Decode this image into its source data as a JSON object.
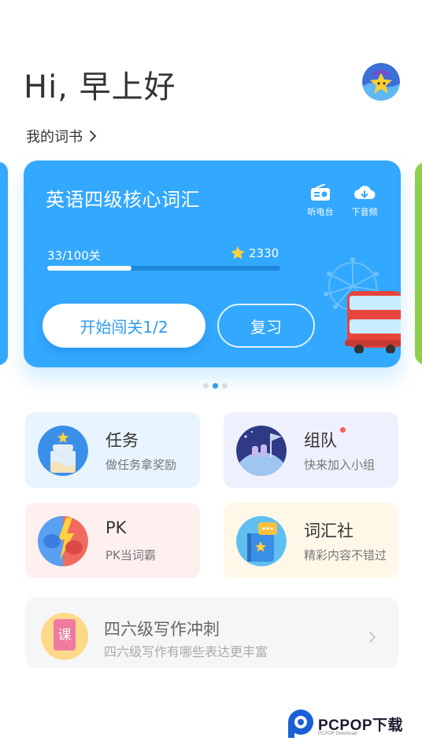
{
  "header": {
    "greeting": "Hi, 早上好",
    "my_book_label": "我的词书"
  },
  "card": {
    "title": "英语四级核心词汇",
    "tools": [
      {
        "label": "听电台"
      },
      {
        "label": "下音频"
      }
    ],
    "progress_text": "33/100关",
    "progress_fraction": 0.36,
    "stars": "2330",
    "start_button": "开始闯关1/2",
    "review_button": "复习"
  },
  "carousel": {
    "page_count": 3,
    "active_index": 1
  },
  "tiles": [
    {
      "title": "任务",
      "subtitle": "做任务拿奖励"
    },
    {
      "title": "组队",
      "subtitle": "快来加入小组"
    },
    {
      "title": "PK",
      "subtitle": "PK当词霸"
    },
    {
      "title": "词汇社",
      "subtitle": "精彩内容不错过"
    }
  ],
  "banner": {
    "badge": "课",
    "title": "四六级写作冲刺",
    "subtitle": "四六级写作有哪些表达更丰富"
  },
  "watermark": {
    "text": "PCPOP下载",
    "subtext": "PCPOP Download"
  },
  "colors": {
    "accent": "#33a8ff",
    "green_card": "#8dd04b",
    "task_bg": "#e8f4ff",
    "team_bg": "#eef1fd",
    "pk_bg": "#fff0f0",
    "vocab_bg": "#fff8e8"
  }
}
